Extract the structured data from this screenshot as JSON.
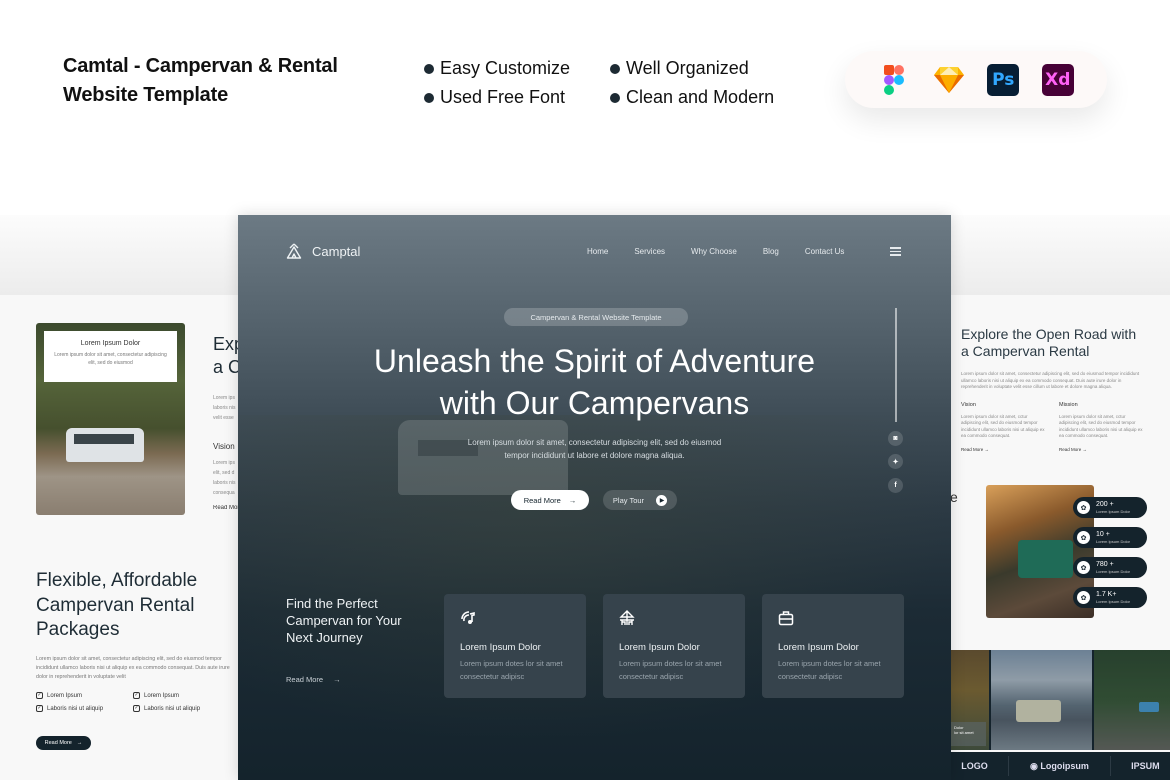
{
  "header": {
    "title_line1": "Camtal - Campervan & Rental",
    "title_line2": "Website Template",
    "features_col1": [
      "Easy Customize",
      "Used Free Font"
    ],
    "features_col2": [
      "Well Organized",
      "Clean and Modern"
    ],
    "tools": [
      {
        "name": "figma-icon",
        "label": ""
      },
      {
        "name": "sketch-icon",
        "label": ""
      },
      {
        "name": "photoshop-icon",
        "label": "Ps"
      },
      {
        "name": "xd-icon",
        "label": "Xd"
      }
    ]
  },
  "hero": {
    "brand": "Camptal",
    "nav": [
      "Home",
      "Services",
      "Why Choose",
      "Blog",
      "Contact Us"
    ],
    "pill": "Campervan & Rental Website Template",
    "title_line1": "Unleash the Spirit of Adventure",
    "title_line2": "with Our Campervans",
    "desc_line1": "Lorem ipsum dolor sit amet, consectetur adipiscing elit, sed do eiusmod",
    "desc_line2": "tempor incididunt ut labore et dolore magna aliqua.",
    "read_more": "Read More",
    "play_tour": "Play Tour",
    "social": [
      "instagram",
      "twitter",
      "facebook"
    ],
    "social_glyphs": [
      "◙",
      "✦",
      "f"
    ]
  },
  "find": {
    "title_line1": "Find the Perfect",
    "title_line2": "Campervan for Your",
    "title_line3": "Next Journey",
    "read_more": "Read More",
    "cards": [
      {
        "icon": "signal-icon",
        "glyph": "◔",
        "title": "Lorem Ipsum Dolor",
        "desc_line1": "Lorem ipsum dotes lor sit amet",
        "desc_line2": "consectetur adipisc"
      },
      {
        "icon": "campsite-icon",
        "glyph": "⛺",
        "title": "Lorem Ipsum Dolor",
        "desc_line1": "Lorem ipsum dotes lor sit amet",
        "desc_line2": "consectetur adipisc"
      },
      {
        "icon": "briefcase-icon",
        "glyph": "▣",
        "title": "Lorem Ipsum Dolor",
        "desc_line1": "Lorem ipsum dotes lor sit amet",
        "desc_line2": "consectetur adipisc"
      }
    ]
  },
  "left_preview": {
    "card_title": "Lorem Ipsum Dolor",
    "card_desc": "Lorem ipsum dolor sit amet, consectetur adipiscing elit, sed do eiusmod",
    "explore_line1": "Exp",
    "explore_line2": "a C",
    "small_lines": [
      "Lorem ips",
      "laboris nis",
      "velit esse"
    ],
    "vision": "Vision",
    "vision_lines": [
      "Lorem ips",
      "elit, sed d",
      "laboris nis",
      "consequa"
    ],
    "read_more": "Read More",
    "flex_title_line1": "Flexible, Affordable",
    "flex_title_line2": "Campervan Rental",
    "flex_title_line3": "Packages",
    "flex_desc": "Lorem ipsum dolor sit amet, consectetur adipiscing elit, sed do eiusmod tempor incididunt ullamco laboris nisi ut aliquip ex ea commodo consequat. Duis aute irure dolor in reprehenderit in voluptate velit",
    "checks": [
      "Lorem Ipsum",
      "Lorem Ipsum",
      "Laboris nisi ut aliquip",
      "Laboris nisi ut aliquip"
    ],
    "flex_button": "Read More"
  },
  "right_preview": {
    "title_line1": "Explore the Open Road with",
    "title_line2": "a Campervan Rental",
    "desc": "Lorem ipsum dolor sit amet, consectetur adipiscing elit, sed do eiusmod tempor incididunt ullamco laboris nisi ut aliquip ex ea commodo consequat. Duis aute irure dolor in reprehenderit in voluptate velit esse cillum ut labore et dolore magna aliqua.",
    "vision_title": "Vision",
    "vision_desc": "Lorem ipsum dolor sit amet, cctur adipiscing elit, sed do eiusmod tempor incididunt ullamco laboris nisi ut aliquip ex ea commodo consequat.",
    "mission_title": "Mission",
    "mission_desc": "Lorem ipsum dolor sit amet, cctur adipiscing elit, sed do eiusmod tempor incididunt ullamco laboris nisi ut aliquip ex ea commodo consequat.",
    "read_more": "Read More",
    "cut_letter": "e",
    "stats": [
      {
        "value": "200 +",
        "label": "Lorem Ipsum Dolor"
      },
      {
        "value": "10 +",
        "label": "Lorem Ipsum Dolor"
      },
      {
        "value": "780 +",
        "label": "Lorem Ipsum Dolor"
      },
      {
        "value": "1.7 K+",
        "label": "Lorem Ipsum Dolor"
      }
    ],
    "gallery_overlay_title": "Dolor",
    "gallery_overlay_desc": "lor sit amet",
    "logos": [
      "LOGO",
      "Logoipsum",
      "IPSUM"
    ]
  }
}
